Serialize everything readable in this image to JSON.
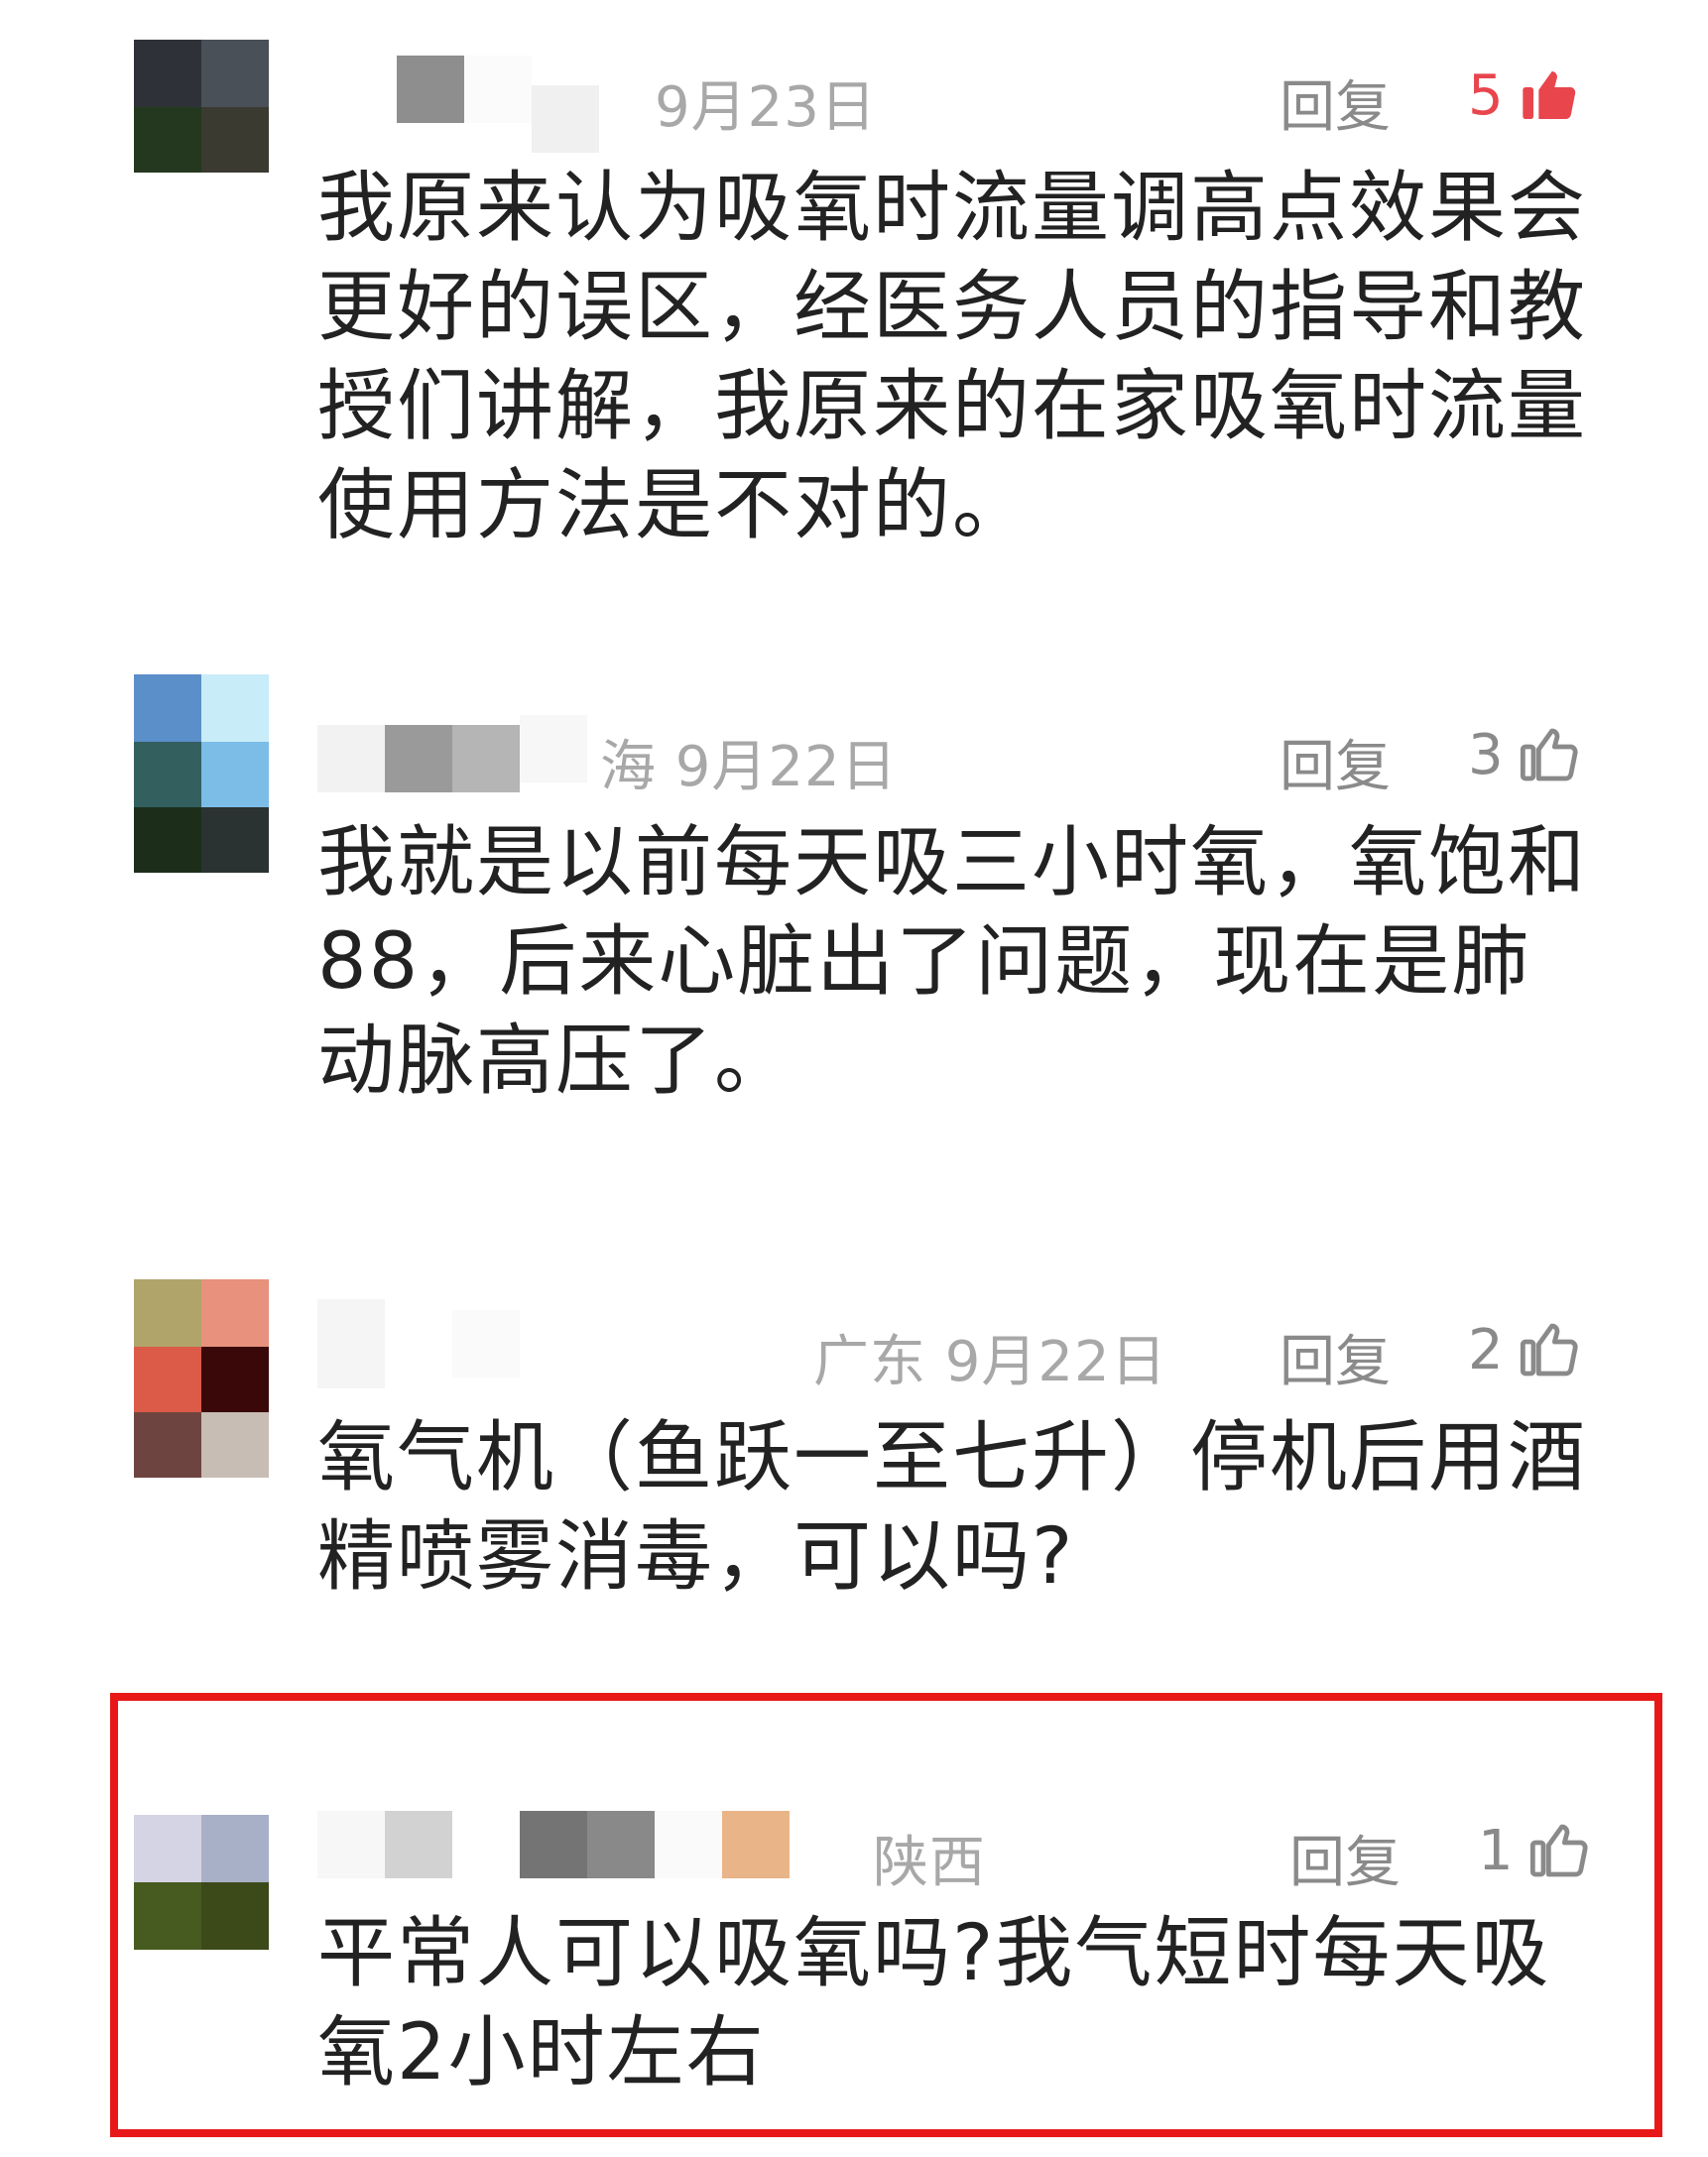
{
  "comments": [
    {
      "location_date": "9月23日",
      "reply_label": "回复",
      "likes": "5",
      "liked": true,
      "text": "我原来认为吸氧时流量调高点效果会更好的误区，经医务人员的指导和教授们讲解，我原来的在家吸氧时流量使用方法是不对的。"
    },
    {
      "location_date": "海 9月22日",
      "reply_label": "回复",
      "likes": "3",
      "liked": false,
      "text": "我就是以前每天吸三小时氧，氧饱和88，后来心脏出了问题，现在是肺动脉高压了。"
    },
    {
      "location_date": "广东 9月22日",
      "reply_label": "回复",
      "likes": "2",
      "liked": false,
      "text": "氧气机（鱼跃一至七升）停机后用酒精喷雾消毒，可以吗?"
    },
    {
      "location_date": "陕西",
      "reply_label": "回复",
      "likes": "1",
      "liked": false,
      "text": "平常人可以吸氧吗?我气短时每天吸氧2小时左右"
    }
  ],
  "colors": {
    "liked": "#e8454d",
    "meta_text": "#a8a8a8",
    "body_text": "#222222",
    "highlight_border": "#e81818"
  },
  "icons": [
    "thumbs-up-filled-icon",
    "thumbs-up-outline-icon"
  ]
}
